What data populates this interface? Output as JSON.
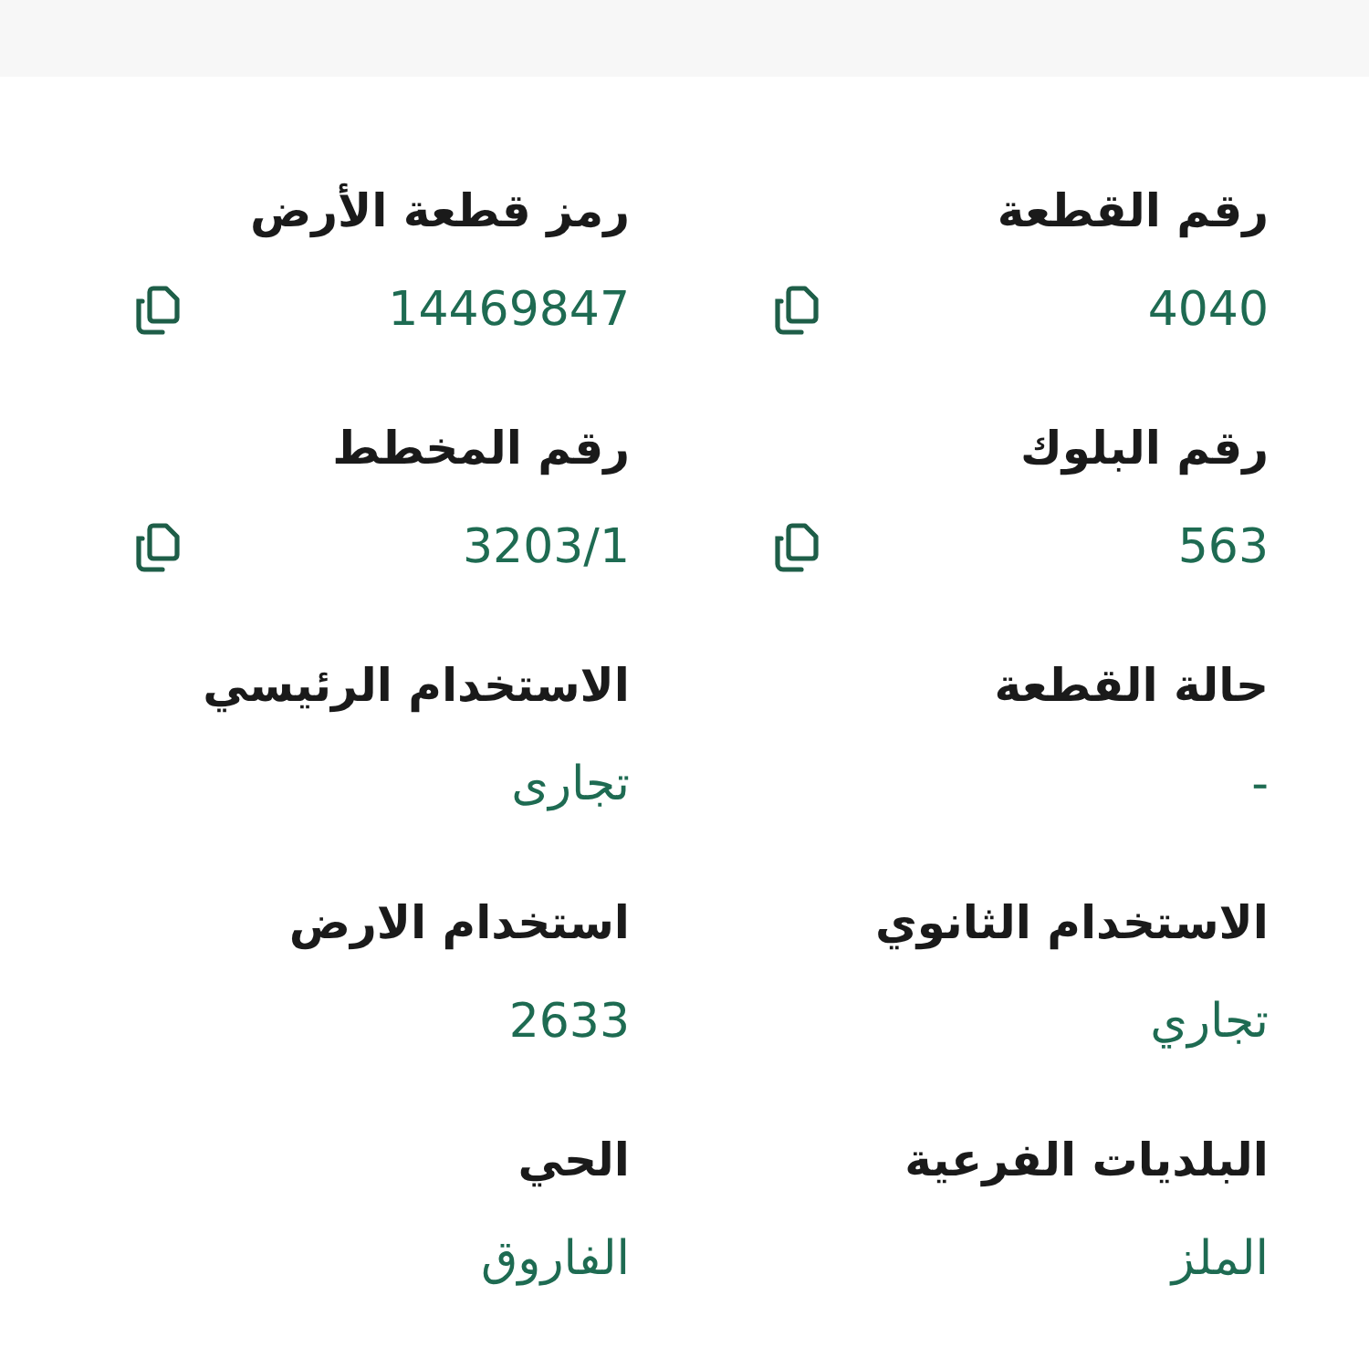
{
  "fields": [
    {
      "label": "رقم القطعة",
      "value": "4040",
      "copyable": true
    },
    {
      "label": "رمز قطعة الأرض",
      "value": "14469847",
      "copyable": true
    },
    {
      "label": "رقم البلوك",
      "value": "563",
      "copyable": true
    },
    {
      "label": "رقم المخطط",
      "value": "3203/1",
      "copyable": true
    },
    {
      "label": "حالة القطعة",
      "value": "-",
      "copyable": false
    },
    {
      "label": "الاستخدام الرئيسي",
      "value": "تجارى",
      "copyable": false
    },
    {
      "label": "الاستخدام الثانوي",
      "value": "تجاري",
      "copyable": false
    },
    {
      "label": "استخدام الارض",
      "value": "2633",
      "copyable": false
    },
    {
      "label": "البلديات الفرعية",
      "value": "الملز",
      "copyable": false
    },
    {
      "label": "الحي",
      "value": "الفاروق",
      "copyable": false
    }
  ]
}
